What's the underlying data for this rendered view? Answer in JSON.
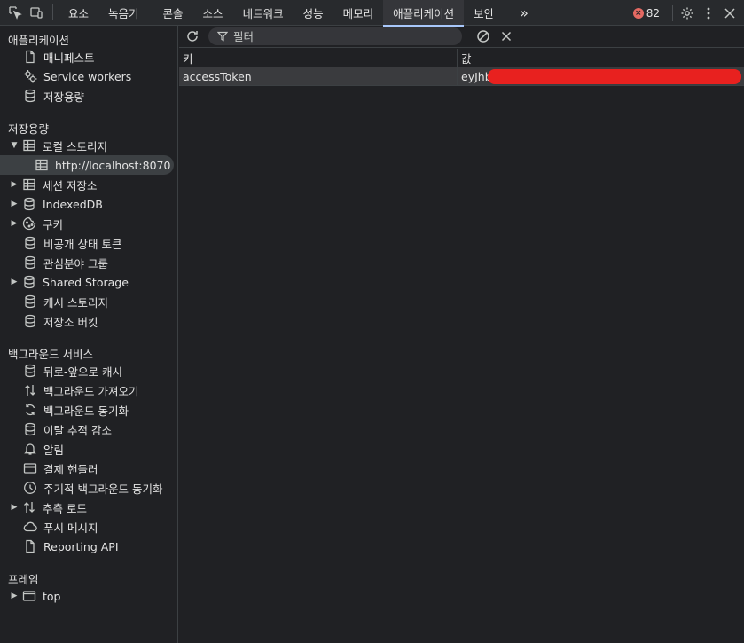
{
  "toolbar": {
    "tabs": [
      "요소",
      "녹음기",
      "콘솔",
      "소스",
      "네트워크",
      "성능",
      "메모리",
      "애플리케이션",
      "보안"
    ],
    "active_tab": "애플리케이션",
    "more_label": "»",
    "error_count": "82",
    "accent": "#a8c7fa"
  },
  "sidebar": {
    "section_app": "애플리케이션",
    "app_items": [
      {
        "label": "매니페스트",
        "icon": "file-icon"
      },
      {
        "label": "Service workers",
        "icon": "gears-icon"
      },
      {
        "label": "저장용량",
        "icon": "database-icon"
      }
    ],
    "section_storage": "저장용량",
    "storage_items": [
      {
        "label": "로컬 스토리지",
        "icon": "table-icon",
        "expanded": true
      },
      {
        "label": "http://localhost:8070",
        "icon": "table-icon",
        "selected": true
      },
      {
        "label": "세션 저장소",
        "icon": "table-icon"
      },
      {
        "label": "IndexedDB",
        "icon": "database-icon"
      },
      {
        "label": "쿠키",
        "icon": "cookie-icon"
      },
      {
        "label": "비공개 상태 토큰",
        "icon": "database-icon"
      },
      {
        "label": "관심분야 그룹",
        "icon": "database-icon"
      },
      {
        "label": "Shared Storage",
        "icon": "database-icon"
      },
      {
        "label": "캐시 스토리지",
        "icon": "database-icon"
      },
      {
        "label": "저장소 버킷",
        "icon": "database-icon"
      }
    ],
    "section_bg": "백그라운드 서비스",
    "bg_items": [
      {
        "label": "뒤로-앞으로 캐시",
        "icon": "database-icon"
      },
      {
        "label": "백그라운드 가져오기",
        "icon": "swap-arrows-icon"
      },
      {
        "label": "백그라운드 동기화",
        "icon": "sync-icon"
      },
      {
        "label": "이탈 추적 감소",
        "icon": "database-icon"
      },
      {
        "label": "알림",
        "icon": "bell-icon"
      },
      {
        "label": "결제 핸들러",
        "icon": "credit-card-icon"
      },
      {
        "label": "주기적 백그라운드 동기화",
        "icon": "clock-icon"
      },
      {
        "label": "추측 로드",
        "icon": "swap-arrows-icon"
      },
      {
        "label": "푸시 메시지",
        "icon": "cloud-icon"
      },
      {
        "label": "Reporting API",
        "icon": "file-icon"
      }
    ],
    "section_frames": "프레임",
    "frame_items": [
      {
        "label": "top",
        "icon": "window-icon"
      }
    ]
  },
  "main": {
    "filter_placeholder": "필터",
    "columns": {
      "key": "키",
      "value": "값"
    },
    "rows": [
      {
        "key": "accessToken",
        "value": "eyJhb"
      }
    ]
  }
}
